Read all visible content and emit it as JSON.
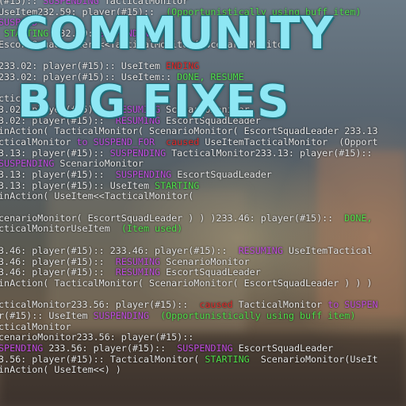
{
  "headline": {
    "line1": "COMMUNITY",
    "line2": "BUG FIXES"
  },
  "colors": {
    "text": "#e6e6e6",
    "suspend": "#c04ce0",
    "starting": "#4ee04a",
    "caused": "#e02a2a",
    "headline": "#8ee7f4"
  },
  "console_lines": [
    [
      {
        "c": "tx",
        "t": "(#15):: "
      },
      {
        "c": "kw",
        "t": "SUSPENDING"
      },
      {
        "c": "tx",
        "t": " TacticalMonitor"
      }
    ],
    [
      {
        "c": "tx",
        "t": "UseItem232.59: player(#15)::  "
      },
      {
        "c": "st",
        "t": "(Opportunistically using buff item)"
      }
    ],
    [
      {
        "c": "kw",
        "t": "SUSPEND"
      }
    ],
    [
      {
        "c": "tx",
        "t": " "
      },
      {
        "c": "st",
        "t": "STARTING"
      },
      {
        "c": "tx",
        "t": " 232.59: "
      },
      {
        "c": "kw",
        "t": "SUSPENDING"
      }
    ],
    [
      {
        "c": "tx",
        "t": "Esco"
      },
      {
        "c": "tx",
        "t": "rtSquadLeader <<TacticalMonitor( ScenarioMonitor"
      }
    ],
    [
      {
        "c": "tx",
        "t": ""
      }
    ],
    [
      {
        "c": "tx",
        "t": "233.02: player(#15):: UseItem "
      },
      {
        "c": "cs",
        "t": "ENDING"
      }
    ],
    [
      {
        "c": "tx",
        "t": "233.02: player(#15):: UseItem:: "
      },
      {
        "c": "st",
        "t": "DONE, RESUME"
      }
    ],
    [
      {
        "c": "tx",
        "t": ""
      }
    ],
    [
      {
        "c": "tx",
        "t": "ctical"
      }
    ],
    [
      {
        "c": "tx",
        "t": "3.02: player(#15)::  "
      },
      {
        "c": "kw",
        "t": "RESUMING"
      },
      {
        "c": "tx",
        "t": " ScenarioMonitor"
      }
    ],
    [
      {
        "c": "tx",
        "t": "3.02: player(#15)::  "
      },
      {
        "c": "kw",
        "t": "RESUMING"
      },
      {
        "c": "tx",
        "t": " EscortSquadLeader"
      }
    ],
    [
      {
        "c": "tx",
        "t": "inAction( TacticalMonitor( ScenarioMonitor( EscortSquadLeader 233.13"
      }
    ],
    [
      {
        "c": "tx",
        "t": "cticalMonitor "
      },
      {
        "c": "kw",
        "t": "to SUSPEND_FOR"
      },
      {
        "c": "tx",
        "t": "  "
      },
      {
        "c": "cs",
        "t": "caused"
      },
      {
        "c": "tx",
        "t": " UseItemTacticalMonitor  (Opport"
      }
    ],
    [
      {
        "c": "tx",
        "t": "3.13: player(#15):: "
      },
      {
        "c": "kw",
        "t": "SUSPENDING"
      },
      {
        "c": "tx",
        "t": " TacticalMonitor233.13: player(#15)::"
      }
    ],
    [
      {
        "c": "kw",
        "t": "SUSPENDING"
      },
      {
        "c": "tx",
        "t": " ScenarioMonitor"
      }
    ],
    [
      {
        "c": "tx",
        "t": "3.13: player(#15)::  "
      },
      {
        "c": "kw",
        "t": "SUSPENDING"
      },
      {
        "c": "tx",
        "t": " EscortSquadLeader"
      }
    ],
    [
      {
        "c": "tx",
        "t": "3.13: player(#15):: UseItem "
      },
      {
        "c": "st",
        "t": "STARTING"
      }
    ],
    [
      {
        "c": "tx",
        "t": "inAction( UseItem<<TacticalMonitor("
      }
    ],
    [
      {
        "c": "tx",
        "t": ""
      }
    ],
    [
      {
        "c": "tx",
        "t": "cenarioMonitor( EscortSquadLeader ) ) )233.46: player(#15)::  "
      },
      {
        "c": "st",
        "t": "DONE,"
      }
    ],
    [
      {
        "c": "tx",
        "t": "cticalMonitorUseItem  "
      },
      {
        "c": "st",
        "t": "(Item used)"
      }
    ],
    [
      {
        "c": "tx",
        "t": ""
      }
    ],
    [
      {
        "c": "tx",
        "t": "3.46: player(#15):: 233.46: player(#15)::  "
      },
      {
        "c": "kw",
        "t": "RESUMING"
      },
      {
        "c": "tx",
        "t": " UseItemTactical"
      }
    ],
    [
      {
        "c": "tx",
        "t": "3.46: player(#15)::  "
      },
      {
        "c": "kw",
        "t": "RESUMING"
      },
      {
        "c": "tx",
        "t": " ScenarioMonitor"
      }
    ],
    [
      {
        "c": "tx",
        "t": "3.46: player(#15)::  "
      },
      {
        "c": "kw",
        "t": "RESUMING"
      },
      {
        "c": "tx",
        "t": " EscortSquadLeader"
      }
    ],
    [
      {
        "c": "tx",
        "t": "inAction( TacticalMonitor( ScenarioMonitor( EscortSquadLeader ) ) )"
      }
    ],
    [
      {
        "c": "tx",
        "t": ""
      }
    ],
    [
      {
        "c": "tx",
        "t": "cticalMonitor233.56: player(#15)::  "
      },
      {
        "c": "cs",
        "t": "caused"
      },
      {
        "c": "tx",
        "t": " TacticalMonitor "
      },
      {
        "c": "kw",
        "t": "to SUSPEN"
      }
    ],
    [
      {
        "c": "tx",
        "t": "r(#15):: UseItem "
      },
      {
        "c": "kw",
        "t": "SUSPENDING"
      },
      {
        "c": "tx",
        "t": "  "
      },
      {
        "c": "st",
        "t": "(Opportunistically using buff item)"
      }
    ],
    [
      {
        "c": "tx",
        "t": "cticalMonitor"
      }
    ],
    [
      {
        "c": "tx",
        "t": "cenarioMonitor233.56: player(#15)::"
      }
    ],
    [
      {
        "c": "kw",
        "t": "SPENDING"
      },
      {
        "c": "tx",
        "t": " 233.56: player(#15)::  "
      },
      {
        "c": "kw",
        "t": "SUSPENDING"
      },
      {
        "c": "tx",
        "t": " EscortSquadLeader"
      }
    ],
    [
      {
        "c": "tx",
        "t": "3.56: player(#15):: TacticalMonitor( "
      },
      {
        "c": "st",
        "t": "STARTING"
      },
      {
        "c": "tx",
        "t": "  ScenarioMonitor(UseIt"
      }
    ],
    [
      {
        "c": "tx",
        "t": "inAction( UseItem<<) )"
      }
    ]
  ]
}
